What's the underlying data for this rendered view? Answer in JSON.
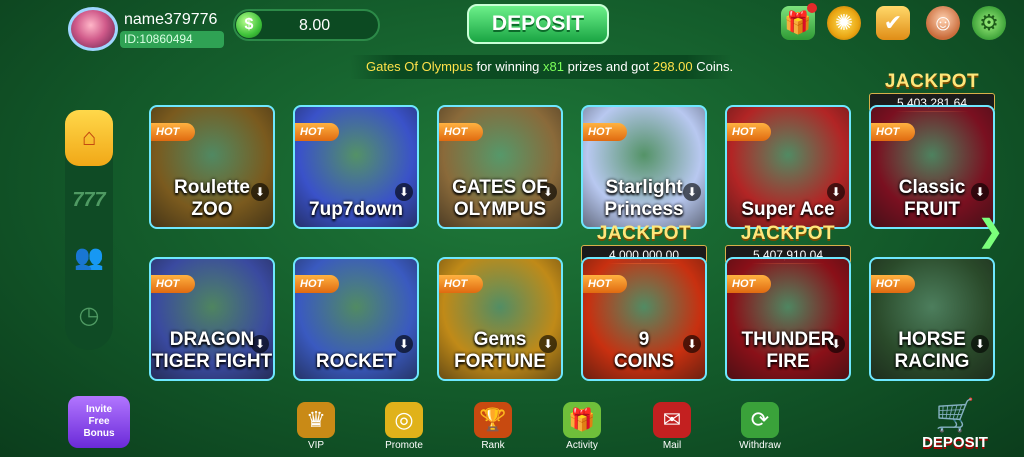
{
  "user": {
    "name": "name379776",
    "id": "ID:10860494"
  },
  "balance": {
    "currency_symbol": "$",
    "value": "8.00"
  },
  "header": {
    "deposit_label": "DEPOSIT"
  },
  "marquee": {
    "game": "Gates Of Olympus",
    "text_mid": " for winning ",
    "multiplier": "x81",
    "text_mid2": " prizes and got ",
    "amount": "298.00",
    "text_end": " Coins."
  },
  "top_icons": [
    "gift-icon",
    "lucky-wheel-icon",
    "checkin-icon",
    "support-icon",
    "settings-gear-icon"
  ],
  "sidenav": {
    "slots_label": "777"
  },
  "games": [
    {
      "title": "Roulette",
      "subtitle": "ZOO",
      "hot": "HOT",
      "bg": "#7a5a1e"
    },
    {
      "title": "7up7down",
      "subtitle": "",
      "hot": "HOT",
      "bg": "#3a52c9"
    },
    {
      "title": "GATES OF",
      "subtitle": "OLYMPUS",
      "hot": "HOT",
      "bg": "#8a6a3a"
    },
    {
      "title": "Starlight",
      "subtitle": "Princess",
      "hot": "HOT",
      "bg": "#b8c8f0"
    },
    {
      "title": "Super Ace",
      "subtitle": "",
      "hot": "HOT",
      "bg": "#b22525"
    },
    {
      "title": "Classic",
      "subtitle": "FRUIT",
      "hot": "HOT",
      "bg": "#7a1020",
      "jackpot_label": "JACKPOT",
      "jackpot": "5,403,281.64"
    },
    {
      "title": "DRAGON",
      "subtitle": "TIGER FIGHT",
      "hot": "HOT",
      "bg": "#3a4aa0"
    },
    {
      "title": "ROCKET",
      "subtitle": "",
      "hot": "HOT",
      "bg": "#3a5ac0"
    },
    {
      "title": "Gems",
      "subtitle": "FORTUNE",
      "hot": "HOT",
      "bg": "#c08a18"
    },
    {
      "title": "9",
      "subtitle": "COINS",
      "hot": "HOT",
      "bg": "#c83010",
      "jackpot_label": "JACKPOT",
      "jackpot": "4,000,000.00"
    },
    {
      "title": "THUNDER",
      "subtitle": "FIRE",
      "hot": "HOT",
      "bg": "#8a1018",
      "jackpot_label": "JACKPOT",
      "jackpot": "5,407,910.04"
    },
    {
      "title": "HORSE",
      "subtitle": "RACING",
      "hot": "HOT",
      "bg": "#2a4a2a"
    }
  ],
  "invite": {
    "line1": "Invite",
    "line2": "Free",
    "line3": "Bonus"
  },
  "bottom_nav": [
    {
      "label": "VIP",
      "icon": "crown-icon"
    },
    {
      "label": "Promote",
      "icon": "coins-icon"
    },
    {
      "label": "Rank",
      "icon": "trophy-icon"
    },
    {
      "label": "Activity",
      "icon": "gift-box-icon"
    },
    {
      "label": "Mail",
      "icon": "mailbox-icon"
    },
    {
      "label": "Withdraw",
      "icon": "withdraw-icon"
    }
  ],
  "deposit_bottom_label": "DEPOSIT"
}
